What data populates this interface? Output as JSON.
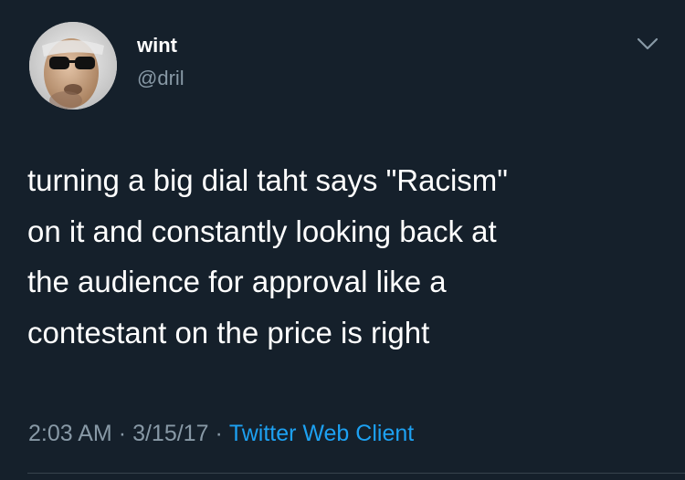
{
  "tweet": {
    "author_name": "wint",
    "author_handle": "@dril",
    "text_lines": [
      "turning a big dial taht says \"Racism\"",
      "on it and constantly looking back at",
      "the audience for approval like a",
      "contestant on the price is right"
    ],
    "time": "2:03 AM",
    "date": "3/15/17",
    "separator": "·",
    "client": "Twitter Web Client"
  },
  "icons": {
    "menu": "chevron-down-icon",
    "avatar": "avatar"
  },
  "colors": {
    "background": "#15202b",
    "text": "#ffffff",
    "secondary": "#8899a6",
    "link": "#1da1f2",
    "divider": "#38444d"
  }
}
